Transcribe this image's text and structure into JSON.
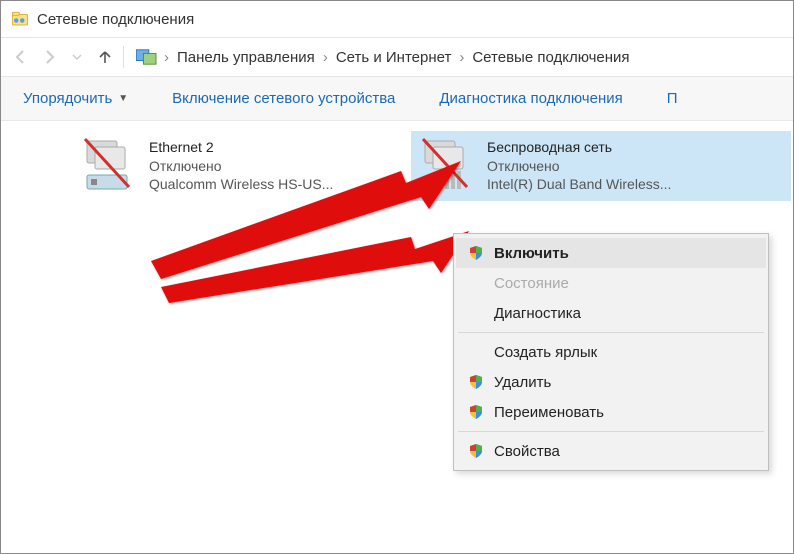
{
  "window": {
    "title": "Сетевые подключения"
  },
  "breadcrumb": {
    "seg1": "Панель управления",
    "seg2": "Сеть и Интернет",
    "seg3": "Сетевые подключения"
  },
  "toolbar": {
    "organize": "Упорядочить",
    "enable": "Включение сетевого устройства",
    "diagnose": "Диагностика подключения",
    "more": "П"
  },
  "conn1": {
    "name": "Ethernet 2",
    "status": "Отключено",
    "device": "Qualcomm Wireless HS-US..."
  },
  "conn2": {
    "name": "Беспроводная сеть",
    "status": "Отключено",
    "device": "Intel(R) Dual Band Wireless..."
  },
  "menu": {
    "enable": "Включить",
    "status": "Состояние",
    "diag": "Диагностика",
    "shortcut": "Создать ярлык",
    "delete": "Удалить",
    "rename": "Переименовать",
    "props": "Свойства"
  }
}
